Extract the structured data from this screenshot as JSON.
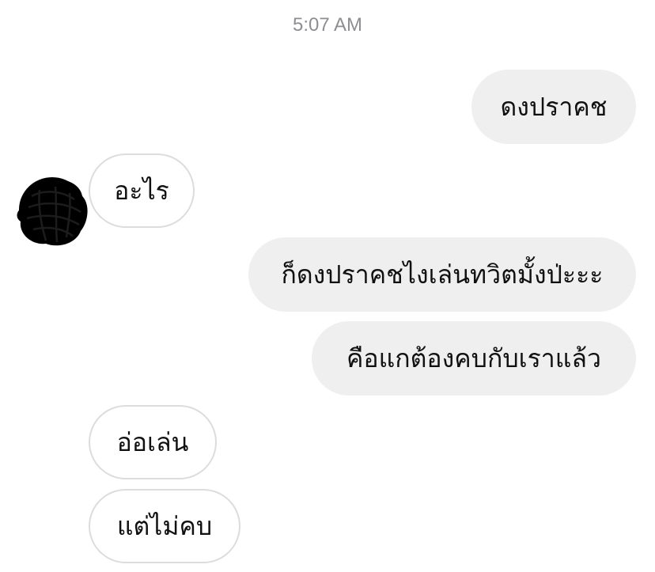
{
  "conversation": {
    "timestamp": "5:07 AM",
    "avatar_icon": "avatar-scribbled-out-icon",
    "messages": [
      {
        "direction": "outgoing",
        "text": "ดงปราคช"
      },
      {
        "direction": "incoming",
        "text": "อะไร"
      },
      {
        "direction": "outgoing",
        "text": "ก็ดงปราคชไงเล่นทวิตมั้งป่ะะะ"
      },
      {
        "direction": "outgoing",
        "text": "คือแกต้องคบกับเราแล้ว"
      },
      {
        "direction": "incoming",
        "text": "อ่อเล่น"
      },
      {
        "direction": "incoming",
        "text": "แต่ไม่คบ"
      }
    ]
  },
  "colors": {
    "outgoing_bubble": "#efefef",
    "incoming_bubble_border": "#dcdcdc",
    "timestamp_text": "#8e8e93",
    "message_text": "#111111"
  }
}
